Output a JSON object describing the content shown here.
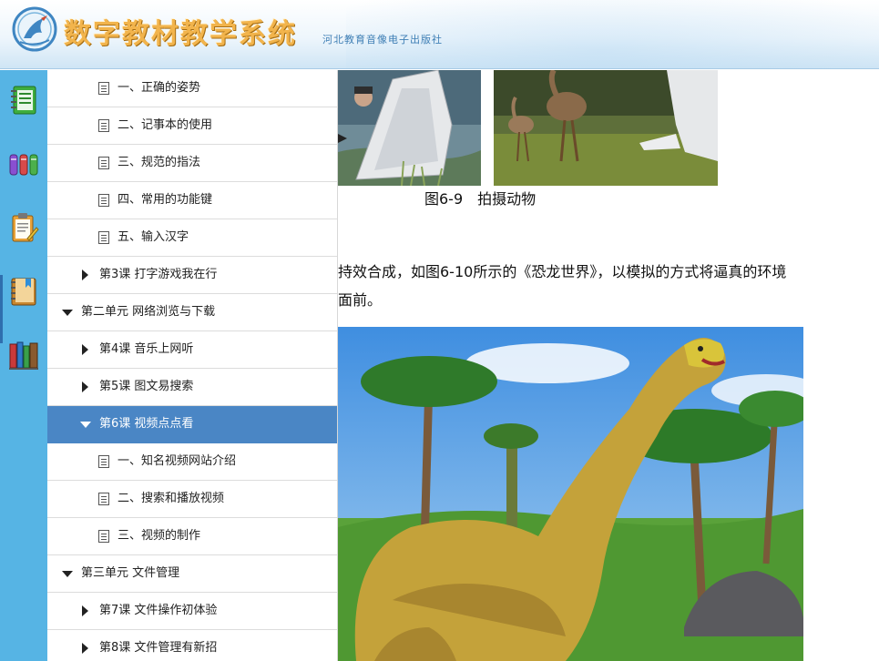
{
  "header": {
    "title": "数字教材教学系统",
    "publisher": "河北教育音像电子出版社",
    "colors": {
      "title": "#f2b44c",
      "publisher": "#3f7fb5",
      "header_bottom": "#cfe5f5"
    }
  },
  "icon_strip": {
    "background": "#56b4e4",
    "icons": [
      "notebook-icon",
      "colored-pencils-icon",
      "clipboard-icon",
      "bookmark-book-icon",
      "bookshelf-icon"
    ]
  },
  "menu": {
    "active_color": "#4a86c5",
    "items": [
      {
        "label": "一、正确的姿势",
        "kind": "section"
      },
      {
        "label": "二、记事本的使用",
        "kind": "section"
      },
      {
        "label": "三、规范的指法",
        "kind": "section"
      },
      {
        "label": "四、常用的功能键",
        "kind": "section"
      },
      {
        "label": "五、输入汉字",
        "kind": "section"
      },
      {
        "label": "第3课 打字游戏我在行",
        "kind": "lesson",
        "expanded": false
      },
      {
        "label": "第二单元 网络浏览与下载",
        "kind": "unit",
        "expanded": true
      },
      {
        "label": "第4课 音乐上网听",
        "kind": "lesson",
        "expanded": false
      },
      {
        "label": "第5课 图文易搜索",
        "kind": "lesson",
        "expanded": false
      },
      {
        "label": "第6课 视频点点看",
        "kind": "lesson",
        "expanded": true,
        "active": true
      },
      {
        "label": "一、知名视频网站介绍",
        "kind": "section"
      },
      {
        "label": "二、搜索和播放视频",
        "kind": "section"
      },
      {
        "label": "三、视频的制作",
        "kind": "section"
      },
      {
        "label": "第三单元 文件管理",
        "kind": "unit",
        "expanded": true
      },
      {
        "label": "第7课 文件操作初体验",
        "kind": "lesson",
        "expanded": false
      },
      {
        "label": "第8课 文件管理有新招",
        "kind": "lesson",
        "expanded": false
      }
    ]
  },
  "content": {
    "figure_caption": "图6-9　拍摄动物",
    "paragraph_lines": [
      "持效合成，如图6-10所示的《恐龙世界》，以模拟的方式将逼真的环境",
      "面前。"
    ]
  }
}
